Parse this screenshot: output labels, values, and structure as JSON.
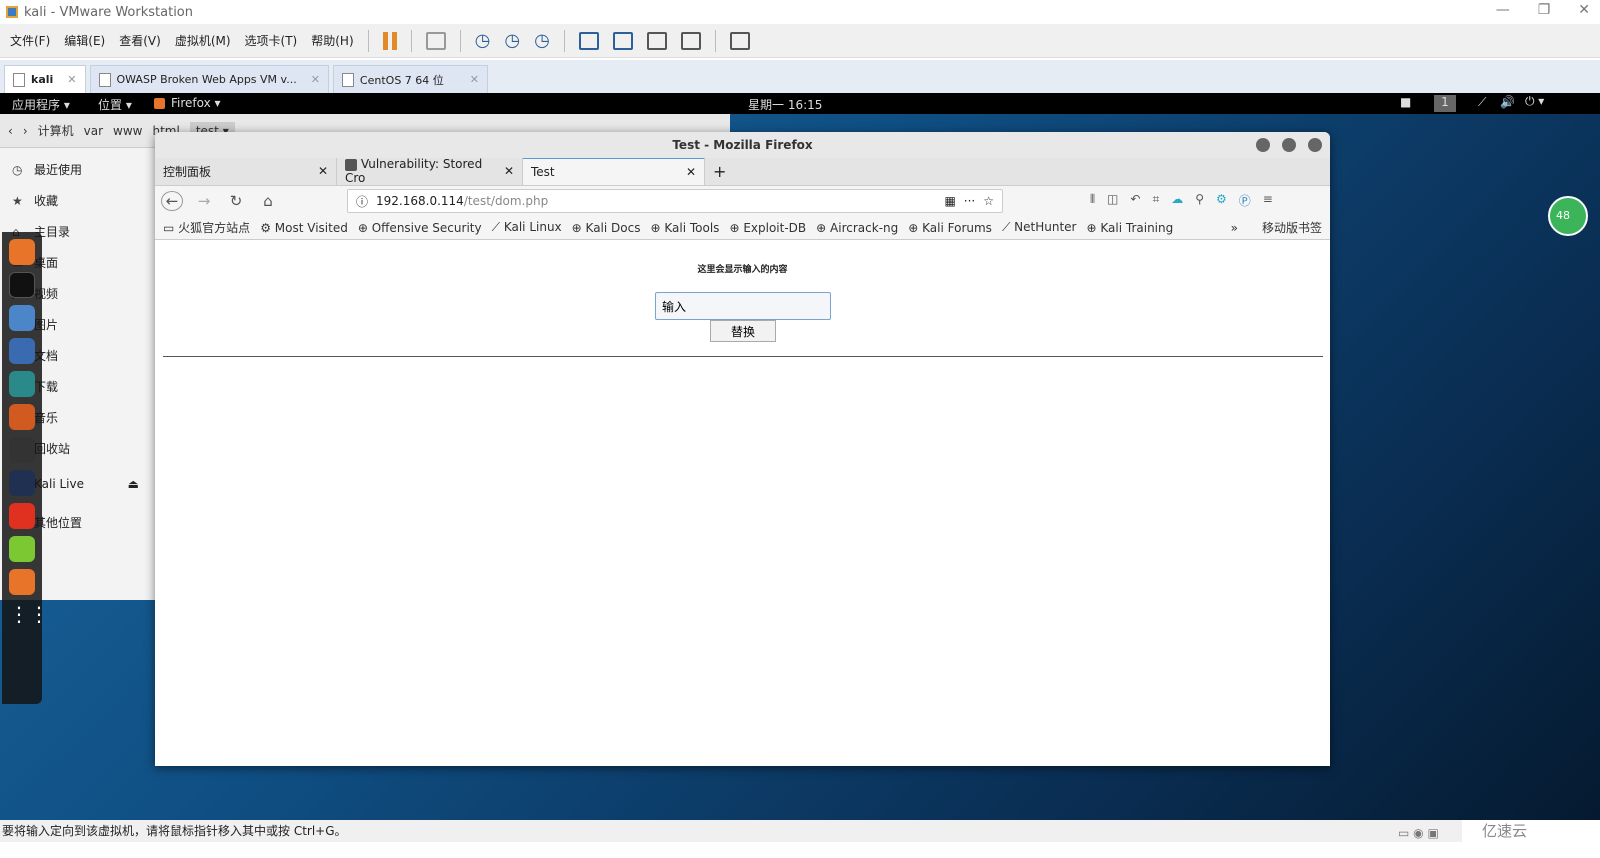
{
  "vmware": {
    "title": "kali - VMware Workstation",
    "menu": [
      "文件(F)",
      "编辑(E)",
      "查看(V)",
      "虚拟机(M)",
      "选项卡(T)",
      "帮助(H)"
    ],
    "tabs": [
      {
        "label": "kali",
        "active": true
      },
      {
        "label": "OWASP Broken Web Apps VM v...",
        "active": false
      },
      {
        "label": "CentOS 7 64 位",
        "active": false
      }
    ],
    "status": "要将输入定向到该虚拟机，请将鼠标指针移入其中或按 Ctrl+G。",
    "watermark": "亿速云"
  },
  "kali": {
    "apps": "应用程序 ▾",
    "places": "位置 ▾",
    "firefox": "Firefox ▾",
    "clock": "星期一 16:15",
    "workspace": "1",
    "badge": "48"
  },
  "nautilus": {
    "path": [
      "计算机",
      "var",
      "www",
      "html",
      "test ▾"
    ],
    "sidebar": [
      {
        "label": "最近使用",
        "icon": "clock-icon"
      },
      {
        "label": "收藏",
        "icon": "star-icon"
      },
      {
        "label": "主目录",
        "icon": "home-icon"
      },
      {
        "label": "桌面",
        "icon": "desktop-icon"
      },
      {
        "label": "视频",
        "icon": "video-icon"
      },
      {
        "label": "图片",
        "icon": "picture-icon"
      },
      {
        "label": "文档",
        "icon": "document-icon"
      },
      {
        "label": "下载",
        "icon": "download-icon"
      },
      {
        "label": "音乐",
        "icon": "music-icon"
      },
      {
        "label": "回收站",
        "icon": "trash-icon"
      },
      {
        "label": "Kali Live",
        "icon": "drive-icon"
      },
      {
        "label": "其他位置",
        "icon": "plus-icon"
      }
    ]
  },
  "firefox": {
    "title": "Test - Mozilla Firefox",
    "tabs": [
      {
        "label": "控制面板"
      },
      {
        "label": "Vulnerability: Stored Cro"
      },
      {
        "label": "Test",
        "active": true
      }
    ],
    "url_host": "192.168.0.114",
    "url_path": "/test/dom.php",
    "bookmarks": [
      "火狐官方站点",
      "Most Visited",
      "Offensive Security",
      "Kali Linux",
      "Kali Docs",
      "Kali Tools",
      "Exploit-DB",
      "Aircrack-ng",
      "Kali Forums",
      "NetHunter",
      "Kali Training"
    ],
    "mobile_bookmarks": "移动版书签"
  },
  "page": {
    "heading": "这里会显示输入的内容",
    "input_value": "输入",
    "button": "替换"
  }
}
